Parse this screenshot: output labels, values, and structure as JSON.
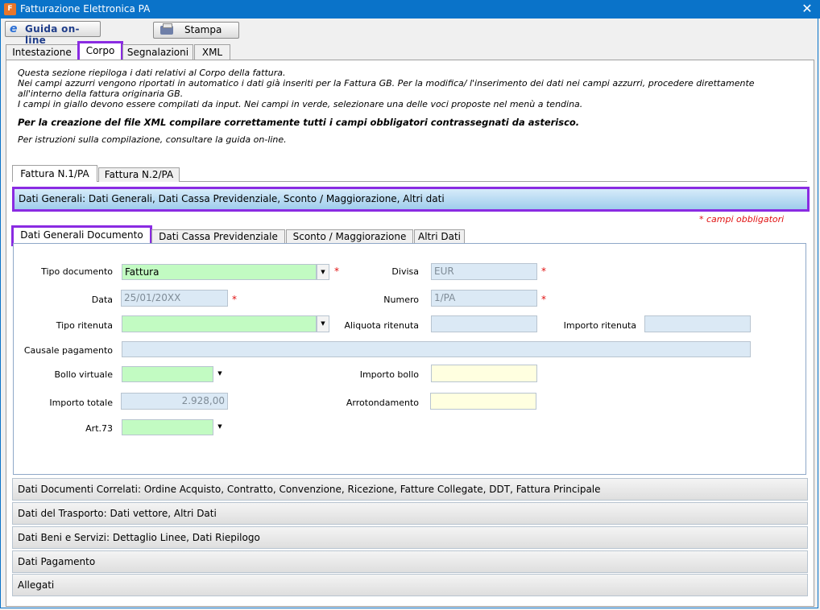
{
  "window": {
    "title": "Fatturazione Elettronica PA",
    "icon_letter": "F",
    "close": "✕"
  },
  "toolbar": {
    "guida_label": "Guida on-line",
    "guida_icon": "e",
    "stampa_label": "Stampa"
  },
  "main_tabs": [
    "Intestazione",
    "Corpo",
    "Segnalazioni",
    "XML"
  ],
  "info": {
    "line1": "Questa sezione riepiloga i dati relativi al Corpo della fattura.",
    "line2": "Nei campi azzurri vengono riportati in automatico i dati già inseriti per la Fattura GB. Per la modifica/ l'inserimento dei dati nei campi azzurri, procedere direttamente",
    "line3": "all'interno della fattura originaria GB.",
    "line4": "I campi in giallo devono essere compilati da input. Nei campi in verde, selezionare una delle voci proposte nel menù a tendina.",
    "bold_line": "Per la creazione del file XML compilare correttamente tutti i campi obbligatori contrassegnati da asterisco.",
    "guide_line": "Per istruzioni sulla compilazione, consultare la guida on-line."
  },
  "invoice_tabs": [
    "Fattura N.1/PA",
    "Fattura N.2/PA"
  ],
  "section_header": "Dati Generali: Dati Generali, Dati Cassa Previdenziale, Sconto / Maggiorazione, Altri dati",
  "required_note": "* campi obbligatori",
  "sub_tabs": [
    "Dati Generali Documento",
    "Dati Cassa Previdenziale",
    "Sconto / Maggiorazione",
    "Altri Dati"
  ],
  "form": {
    "tipo_documento": {
      "label": "Tipo documento",
      "value": "Fattura"
    },
    "divisa": {
      "label": "Divisa",
      "value": "EUR"
    },
    "data": {
      "label": "Data",
      "value": "25/01/20XX"
    },
    "numero": {
      "label": "Numero",
      "value": "1/PA"
    },
    "tipo_ritenuta": {
      "label": "Tipo ritenuta",
      "value": ""
    },
    "aliquota_ritenuta": {
      "label": "Aliquota ritenuta",
      "value": ""
    },
    "importo_ritenuta": {
      "label": "Importo ritenuta",
      "value": ""
    },
    "causale_pagamento": {
      "label": "Causale pagamento",
      "value": ""
    },
    "bollo_virtuale": {
      "label": "Bollo virtuale",
      "value": ""
    },
    "importo_bollo": {
      "label": "Importo bollo",
      "value": ""
    },
    "importo_totale": {
      "label": "Importo totale",
      "value": "2.928,00"
    },
    "arrotondamento": {
      "label": "Arrotondamento",
      "value": ""
    },
    "art73": {
      "label": "Art.73",
      "value": ""
    },
    "star": "*",
    "dropdown_arrow": "▼"
  },
  "accordion": [
    "Dati Documenti Correlati: Ordine Acquisto, Contratto, Convenzione, Ricezione, Fatture Collegate, DDT, Fattura Principale",
    "Dati del Trasporto: Dati vettore, Altri Dati",
    "Dati Beni e Servizi: Dettaglio Linee, Dati Riepilogo",
    "Dati Pagamento",
    "Allegati"
  ],
  "colors": {
    "title_bar": "#0a73c9",
    "highlight": "#8a2be2",
    "field_blue": "#dbe9f5",
    "field_green": "#c2fbc2",
    "field_yellow": "#ffffe0",
    "required": "#e01010"
  }
}
